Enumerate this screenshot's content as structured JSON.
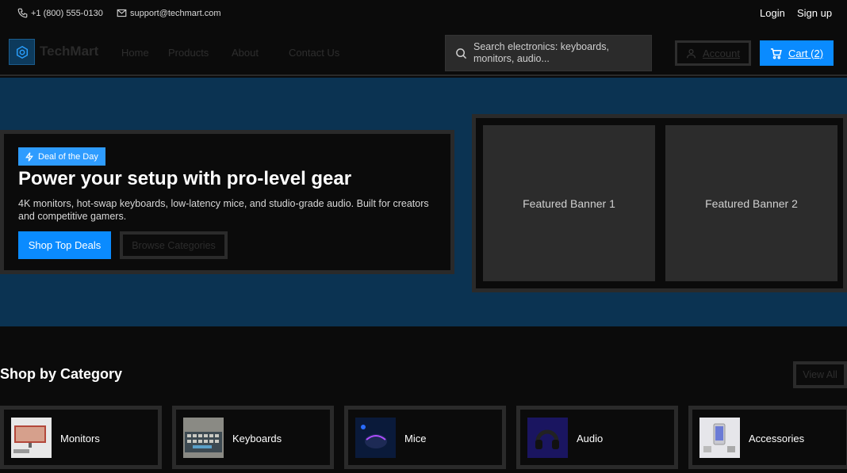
{
  "topbar": {
    "phone": "+1 (800) 555-0130",
    "email": "support@techmart.com",
    "login": "Login",
    "signup": "Sign up"
  },
  "nav": {
    "brand": "TechMart",
    "links": [
      "Home",
      "Products",
      "About",
      "Contact Us"
    ],
    "search_placeholder": "Search electronics: keyboards, monitors, audio...",
    "account_label": "Account",
    "cart_label": "Cart (2)"
  },
  "hero": {
    "badge": "Deal of the Day",
    "title": "Power your setup with pro-level gear",
    "description": "4K monitors, hot-swap keyboards, low-latency mice, and studio-grade audio. Built for creators and competitive gamers.",
    "primary_cta": "Shop Top Deals",
    "secondary_cta": "Browse Categories",
    "banners": [
      "Featured Banner 1",
      "Featured Banner 2"
    ]
  },
  "categories": {
    "title": "Shop by Category",
    "view_all": "View All",
    "items": [
      "Monitors",
      "Keyboards",
      "Mice",
      "Audio",
      "Accessories"
    ]
  },
  "colors": {
    "accent": "#0a8bff",
    "hero_bg": "#0b3352",
    "page_bg": "#0b0b0b"
  }
}
